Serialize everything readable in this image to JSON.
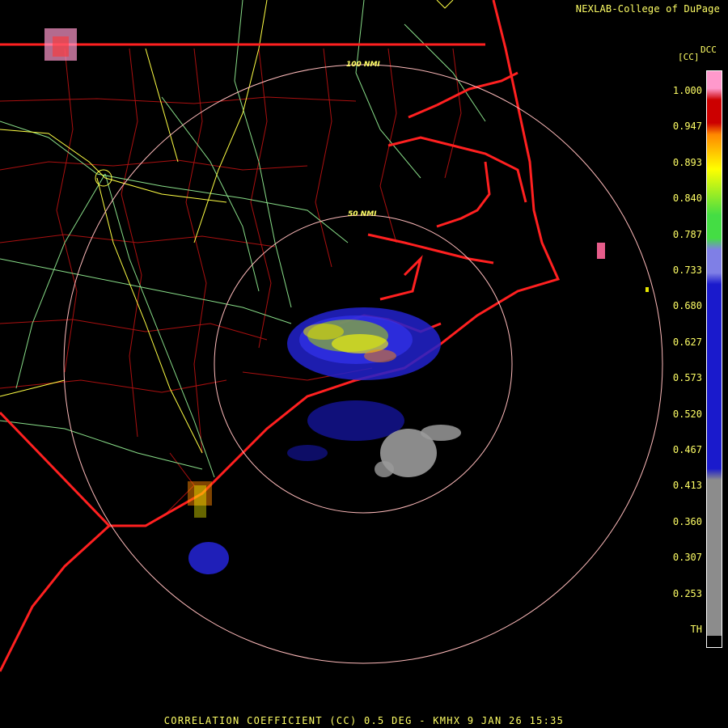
{
  "header": {
    "credit": "NEXLAB-College of DuPage"
  },
  "legend": {
    "product": "DCC",
    "unit": "[CC]",
    "labels": [
      "1.000",
      "0.947",
      "0.893",
      "0.840",
      "0.787",
      "0.733",
      "0.680",
      "0.627",
      "0.573",
      "0.520",
      "0.467",
      "0.413",
      "0.360",
      "0.307",
      "0.253",
      "TH"
    ],
    "colors": {
      "low": "#8c8c8c",
      "mid_low": "#1a1acc",
      "mid": "#7f7fe6",
      "green": "#44dd44",
      "yellow": "#ffff00",
      "orange": "#ff8800",
      "red": "#cc0000",
      "pink": "#ff99cc",
      "black": "#000000"
    }
  },
  "map": {
    "rings": [
      {
        "label": "50 NMI"
      },
      {
        "label": "100 NMI"
      }
    ],
    "colors": {
      "coast": "#ff2020",
      "state_border": "#ff2020",
      "county": "#aa1010",
      "highway": "#88dd88",
      "interstate": "#ffff44",
      "ring": "#ffbbbb"
    }
  },
  "footer": {
    "caption": "CORRELATION COEFFICIENT (CC) 0.5 DEG - KMHX 9 JAN 26 15:35"
  }
}
